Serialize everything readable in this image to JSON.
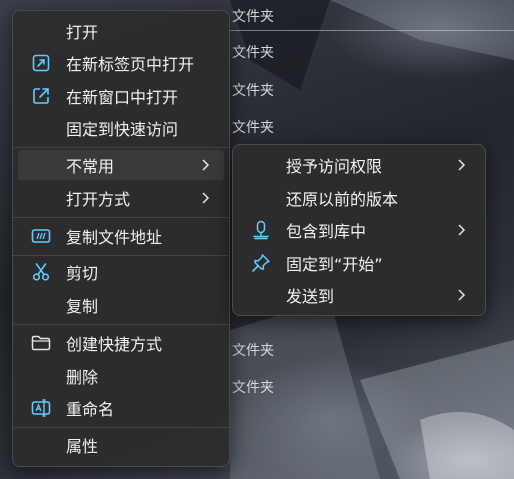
{
  "background": {
    "explorer_rows": [
      {
        "label": "文件夹"
      },
      {
        "label": "文件夹"
      },
      {
        "label": "文件夹"
      },
      {
        "label": "文件夹"
      },
      {
        "label": "文件夹"
      },
      {
        "label": "文件夹"
      }
    ]
  },
  "context_menu": {
    "items": [
      {
        "label": "打开",
        "icon": "none"
      },
      {
        "label": "在新标签页中打开",
        "icon": "new-tab-icon"
      },
      {
        "label": "在新窗口中打开",
        "icon": "new-window-icon"
      },
      {
        "label": "固定到快速访问",
        "icon": "none"
      },
      {
        "label": "不常用",
        "icon": "none",
        "submenu": true
      },
      {
        "label": "打开方式",
        "icon": "none",
        "submenu": true
      },
      {
        "label": "复制文件地址",
        "icon": "copy-path-icon"
      },
      {
        "label": "剪切",
        "icon": "scissors-icon"
      },
      {
        "label": "复制",
        "icon": "none"
      },
      {
        "label": "创建快捷方式",
        "icon": "folder-icon"
      },
      {
        "label": "删除",
        "icon": "none"
      },
      {
        "label": "重命名",
        "icon": "rename-icon"
      },
      {
        "label": "属性",
        "icon": "none"
      }
    ]
  },
  "submenu": {
    "items": [
      {
        "label": "授予访问权限",
        "icon": "none",
        "submenu": true
      },
      {
        "label": "还原以前的版本",
        "icon": "none"
      },
      {
        "label": "包含到库中",
        "icon": "library-icon",
        "submenu": true
      },
      {
        "label": "固定到“开始”",
        "icon": "pin-icon"
      },
      {
        "label": "发送到",
        "icon": "none",
        "submenu": true
      }
    ]
  },
  "colors": {
    "menu_bg": "#2c2c2e",
    "hover_bg": "#3a3a3d",
    "accent_icon": "#60cdff",
    "text": "#f2f2f2"
  }
}
